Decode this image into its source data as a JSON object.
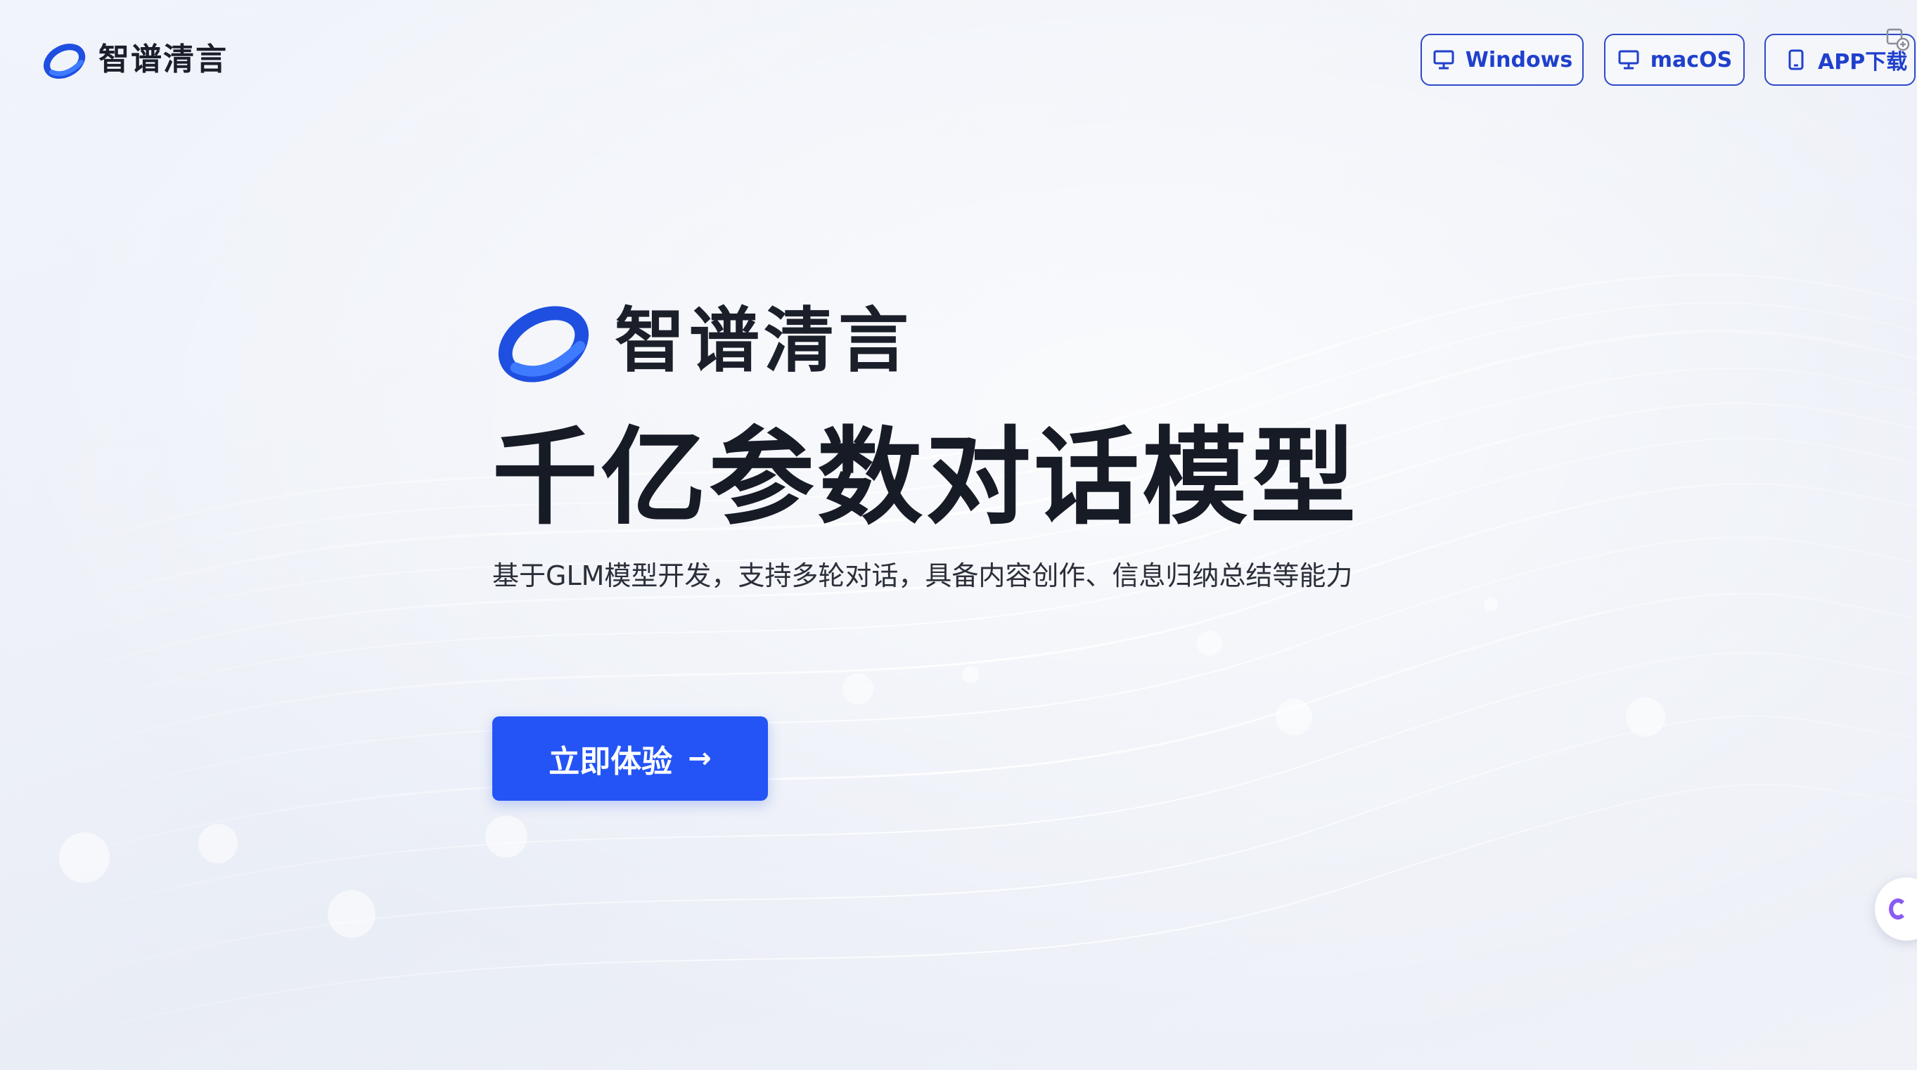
{
  "brand": {
    "name": "智谱清言"
  },
  "header": {
    "buttons": [
      {
        "label": "Windows",
        "icon": "monitor-icon"
      },
      {
        "label": "macOS",
        "icon": "monitor-icon"
      },
      {
        "label": "APP下载",
        "icon": "phone-icon"
      }
    ]
  },
  "hero": {
    "brand_name": "智谱清言",
    "title": "千亿参数对话模型",
    "subtitle": "基于GLM模型开发，支持多轮对话，具备内容创作、信息归纳总结等能力",
    "cta_label": "立即体验",
    "cta_arrow": "→"
  },
  "colors": {
    "accent": "#2454f5",
    "button_border": "#2f49c9",
    "logo_blue": "#1f4fe0",
    "text_dark": "#171b26"
  }
}
